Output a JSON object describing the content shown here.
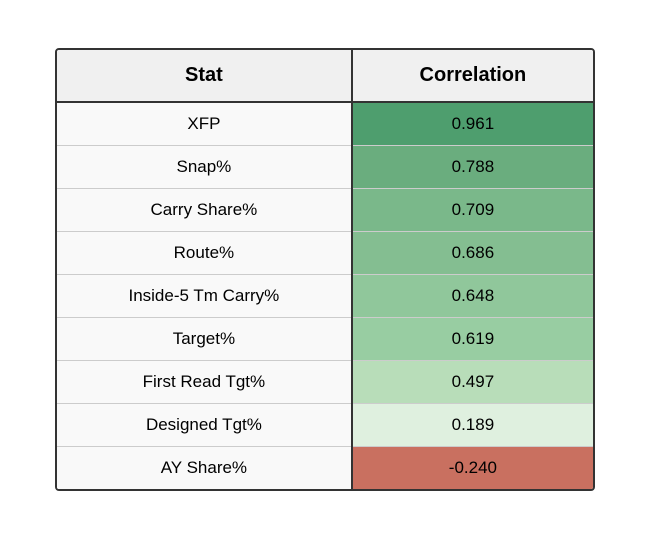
{
  "table": {
    "headers": {
      "stat": "Stat",
      "correlation": "Correlation"
    },
    "rows": [
      {
        "stat": "XFP",
        "correlation": "0.961",
        "color": "#4e9e6e",
        "textColor": "#000"
      },
      {
        "stat": "Snap%",
        "correlation": "0.788",
        "color": "#6aad7e",
        "textColor": "#000"
      },
      {
        "stat": "Carry Share%",
        "correlation": "0.709",
        "color": "#7ab88a",
        "textColor": "#000"
      },
      {
        "stat": "Route%",
        "correlation": "0.686",
        "color": "#84be91",
        "textColor": "#000"
      },
      {
        "stat": "Inside-5 Tm Carry%",
        "correlation": "0.648",
        "color": "#90c79b",
        "textColor": "#000"
      },
      {
        "stat": "Target%",
        "correlation": "0.619",
        "color": "#98cda2",
        "textColor": "#000"
      },
      {
        "stat": "First Read Tgt%",
        "correlation": "0.497",
        "color": "#b8ddb9",
        "textColor": "#000"
      },
      {
        "stat": "Designed Tgt%",
        "correlation": "0.189",
        "color": "#dff0df",
        "textColor": "#000"
      },
      {
        "stat": "AY Share%",
        "correlation": "-0.240",
        "color": "#c97060",
        "textColor": "#000"
      }
    ]
  }
}
